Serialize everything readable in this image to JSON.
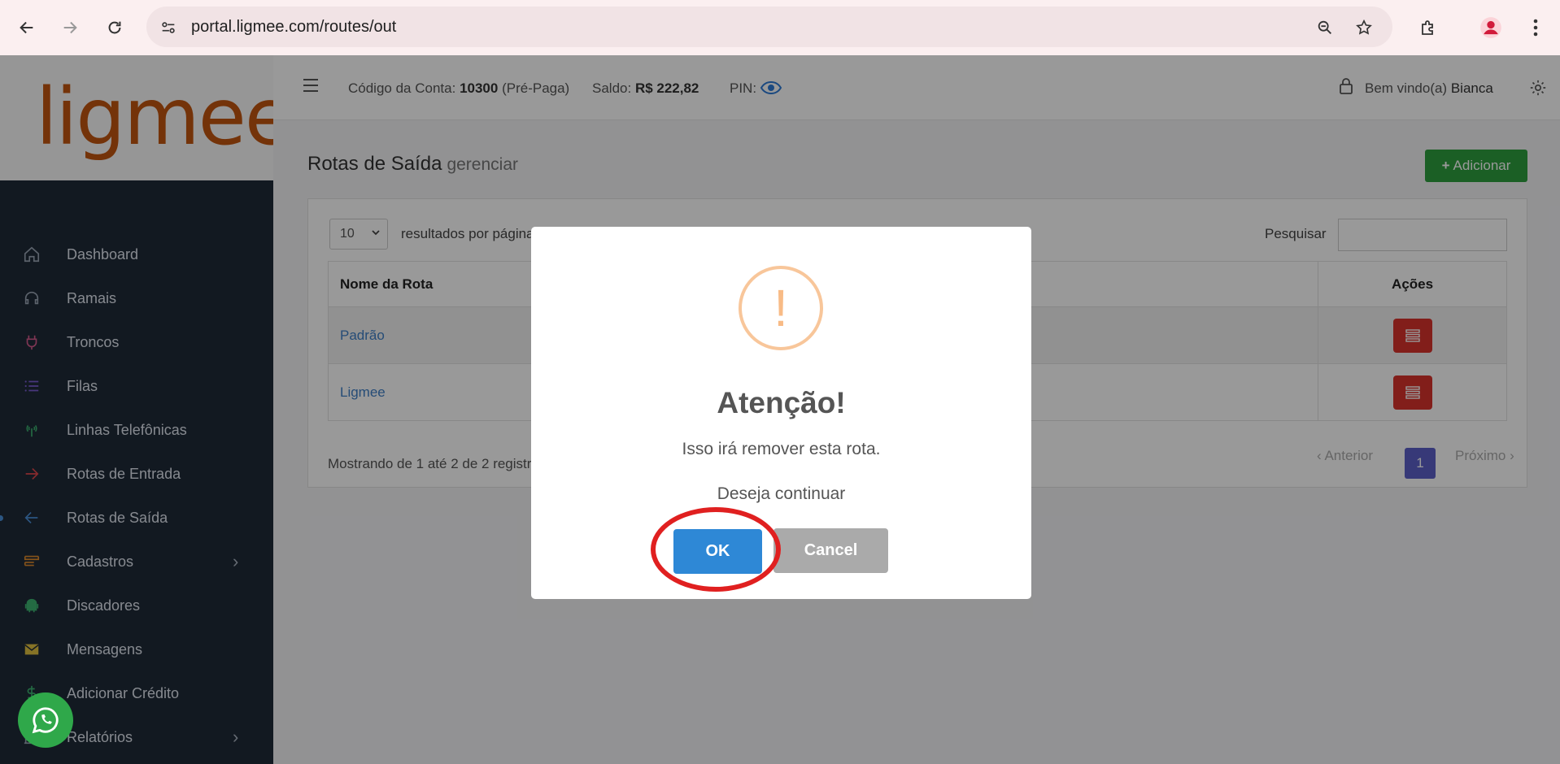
{
  "browser": {
    "url": "portal.ligmee.com/routes/out"
  },
  "logo": "ligmee",
  "sidebar": {
    "items": [
      {
        "label": "Dashboard",
        "icon": "home-icon",
        "color": "#9aa5b5"
      },
      {
        "label": "Ramais",
        "icon": "headset-icon",
        "color": "#9aa5b5"
      },
      {
        "label": "Troncos",
        "icon": "plug-icon",
        "color": "#d45a8c"
      },
      {
        "label": "Filas",
        "icon": "list-icon",
        "color": "#7a5cd0"
      },
      {
        "label": "Linhas Telefônicas",
        "icon": "antenna-icon",
        "color": "#3cb371"
      },
      {
        "label": "Rotas de Entrada",
        "icon": "arrow-right-icon",
        "color": "#e0474c"
      },
      {
        "label": "Rotas de Saída",
        "icon": "arrow-left-icon",
        "color": "#4a8fd9"
      },
      {
        "label": "Cadastros",
        "icon": "stack-icon",
        "color": "#e08a2c"
      },
      {
        "label": "Discadores",
        "icon": "android-icon",
        "color": "#3cb371"
      },
      {
        "label": "Mensagens",
        "icon": "envelope-icon",
        "color": "#e0c040"
      },
      {
        "label": "Adicionar Crédito",
        "icon": "dollar-icon",
        "color": "#3cb371"
      },
      {
        "label": "Relatórios",
        "icon": "chart-icon",
        "color": "#9aa5b5"
      }
    ]
  },
  "header": {
    "account_label": "Código da Conta:",
    "account_code": "10300",
    "account_type": "(Pré-Paga)",
    "balance_label": "Saldo:",
    "balance_value": "R$ 222,82",
    "pin_label": "PIN:",
    "welcome_label": "Bem vindo(a)",
    "user_name": "Bianca"
  },
  "page": {
    "title": "Rotas de Saída",
    "subtitle": "gerenciar",
    "add_label": "Adicionar",
    "page_size": "10",
    "page_size_label": "resultados por página",
    "search_label": "Pesquisar",
    "columns": [
      "Nome da Rota",
      "Ações"
    ],
    "rows": [
      "Padrão",
      "Ligmee"
    ],
    "showing": "Mostrando de 1 até 2 de 2 registros",
    "prev": "Anterior",
    "current_page": "1",
    "next": "Próximo"
  },
  "modal": {
    "icon_glyph": "!",
    "title": "Atenção!",
    "text": "Isso irá remover esta rota.",
    "question": "Deseja continuar",
    "ok_label": "OK",
    "cancel_label": "Cancel"
  }
}
